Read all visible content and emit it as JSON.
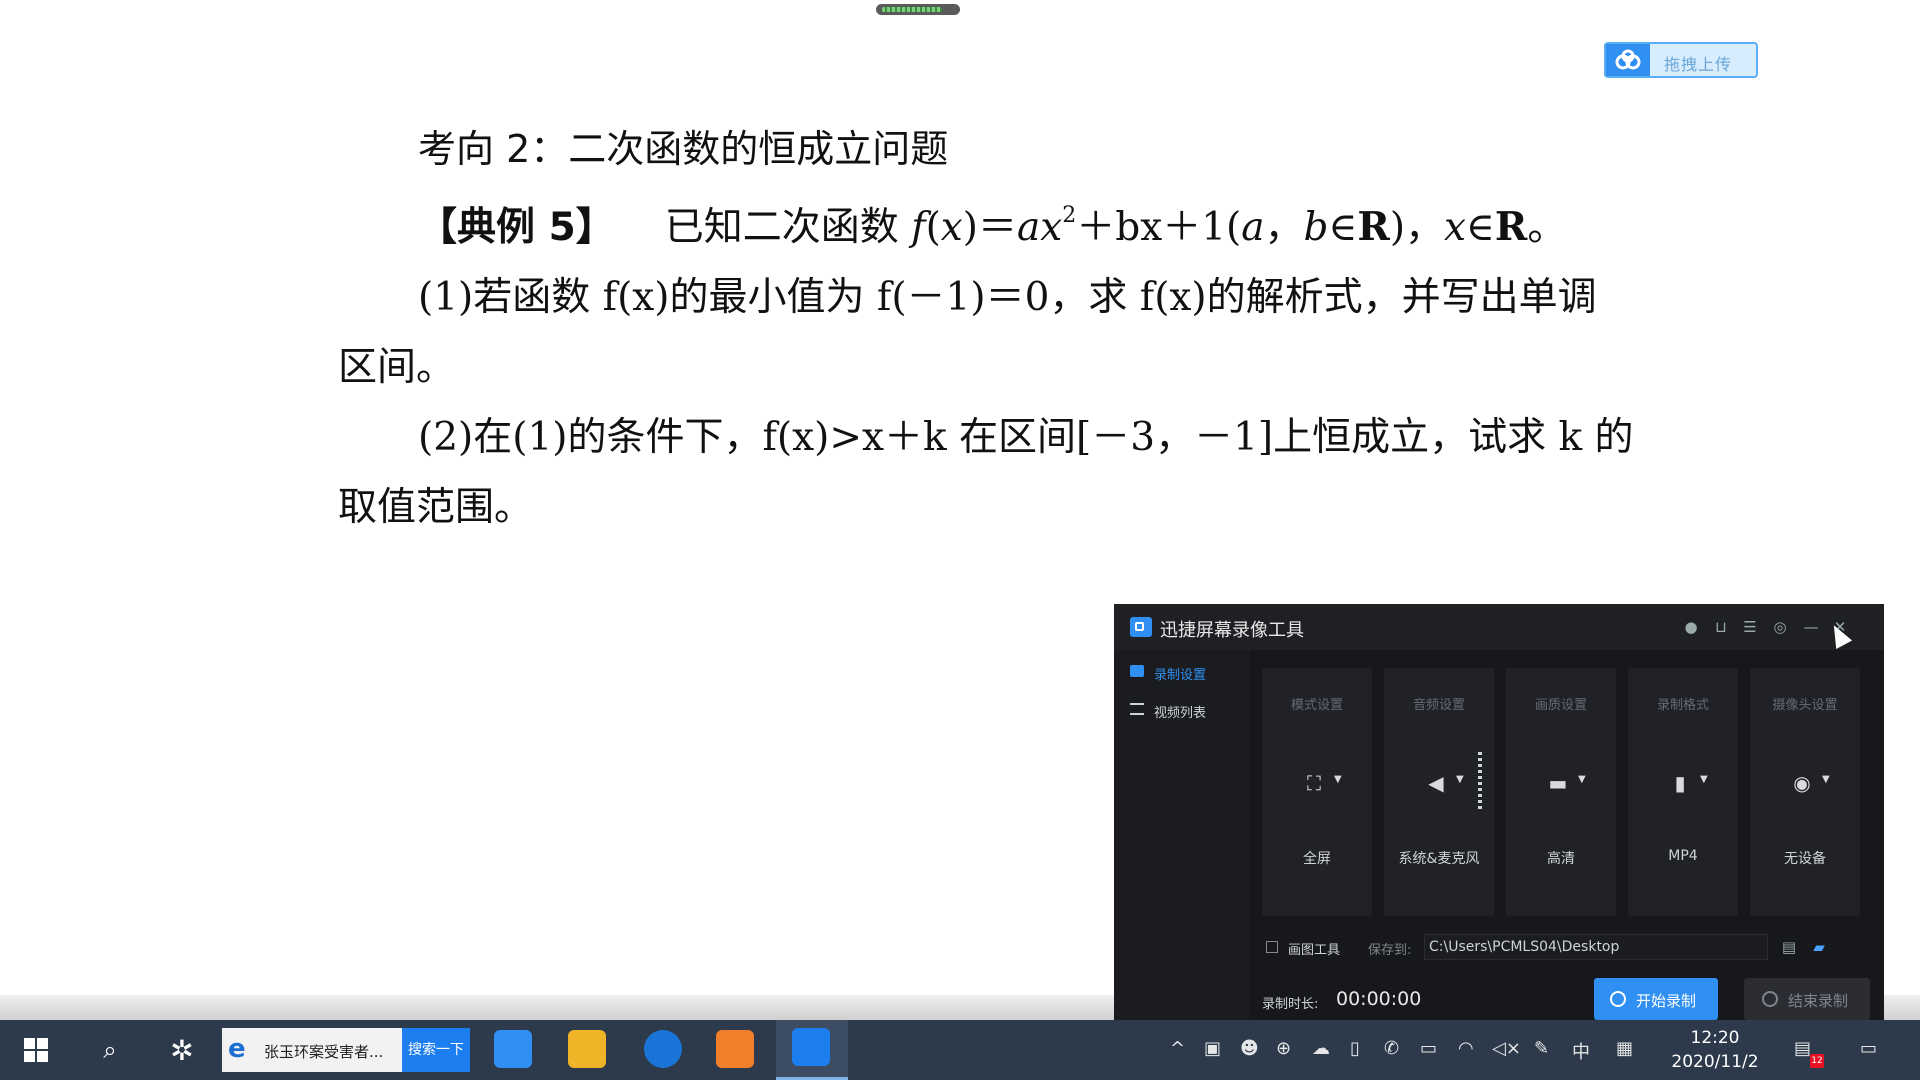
{
  "document": {
    "upload_label": "拖拽上传",
    "heading": "考向 2：二次函数的恒成立问题",
    "example_label": "【典例 5】",
    "line1": {
      "intro": "已知二次函数 ",
      "fx": "f",
      "x": "x",
      "eq": "＝",
      "ax": "ax",
      "exp": "2",
      "rest": "＋bx＋1(",
      "a": "a",
      "comma": "，",
      "b": "b",
      "in_r": "∈",
      "R": "R",
      "close": ")，",
      "x2": "x",
      "in_r2": "∈",
      "R2": "R",
      "end": "。"
    },
    "part1_a": "(1)若函数 f(x)的最小值为 f(－1)＝0，求 f(x)的解析式，并写出单调",
    "part1_b": "区间。",
    "part2_a": "(2)在(1)的条件下，f(x)>x＋k 在区间[－3，－1]上恒成立，试求 k 的",
    "part2_b": "取值范围。"
  },
  "recorder": {
    "title": "迅捷屏幕录像工具",
    "sidebar": [
      {
        "label": "录制设置",
        "active": true
      },
      {
        "label": "视频列表",
        "active": false
      }
    ],
    "cards": [
      {
        "title": "模式设置",
        "value": "全屏",
        "icon": "fullscreen-icon"
      },
      {
        "title": "音频设置",
        "value": "系统&麦克风",
        "icon": "speaker-icon"
      },
      {
        "title": "画质设置",
        "value": "高清",
        "icon": "monitor-icon"
      },
      {
        "title": "录制格式",
        "value": "MP4",
        "icon": "file-icon"
      },
      {
        "title": "摄像头设置",
        "value": "无设备",
        "icon": "camera-icon"
      }
    ],
    "draw_tool_label": "画图工具",
    "save_to_label": "保存到:",
    "save_path": "C:\\Users\\PCMLS04\\Desktop",
    "duration_label": "录制时长:",
    "duration": "00:00:00",
    "start_label": "开始录制",
    "stop_label": "结束录制",
    "accent_color": "#2f8ff2"
  },
  "taskbar": {
    "browser_search_text": "张玉环案受害者...",
    "search_button": "搜索一下",
    "ime_lang": "中",
    "time": "12:20",
    "date": "2020/11/2",
    "notification_count": "12"
  }
}
